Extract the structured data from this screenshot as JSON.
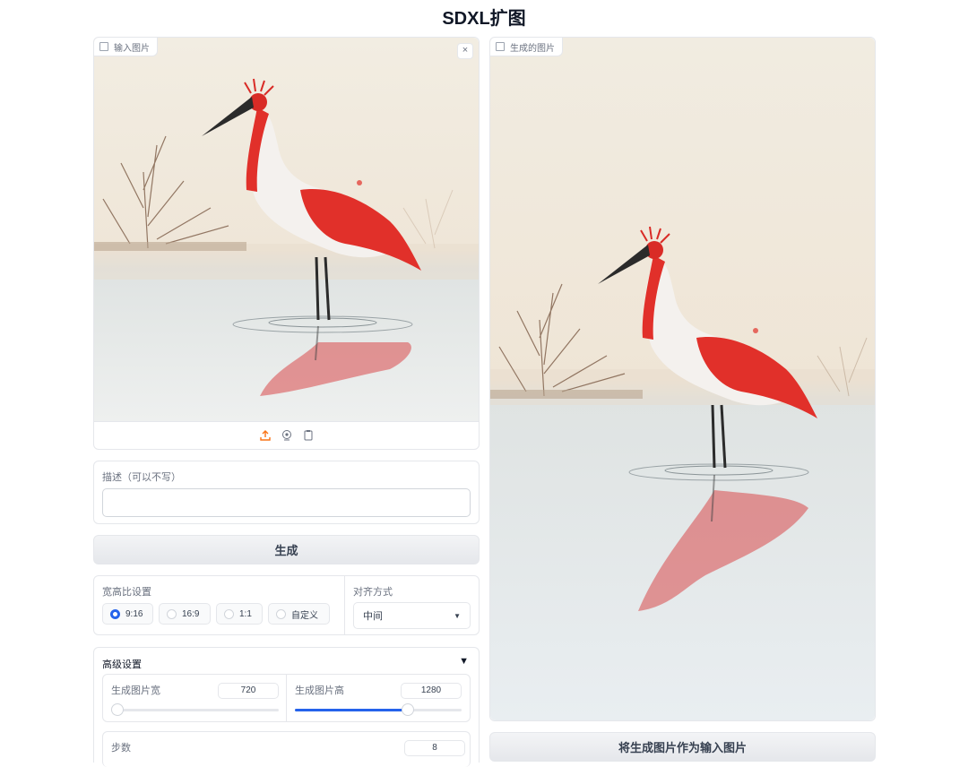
{
  "app": {
    "title": "SDXL扩图"
  },
  "input_image": {
    "label": "输入图片",
    "close_icon": "×"
  },
  "output_image": {
    "label": "生成的图片"
  },
  "description": {
    "label": "描述（可以不写）",
    "value": "",
    "placeholder": ""
  },
  "generate_button": {
    "label": "生成"
  },
  "aspect_ratio": {
    "label": "宽高比设置",
    "options": [
      "9:16",
      "16:9",
      "1:1",
      "自定义"
    ],
    "selected": "9:16"
  },
  "alignment": {
    "label": "对齐方式",
    "value": "中间"
  },
  "advanced": {
    "label": "高级设置",
    "toggle_icon": "▼",
    "width": {
      "label": "生成图片宽",
      "value": "720",
      "fraction": 0
    },
    "height": {
      "label": "生成图片高",
      "value": "1280",
      "fraction": 0.68
    },
    "steps": {
      "label": "步数",
      "value": "8"
    }
  },
  "use_as_input_button": {
    "label": "将生成图片作为输入图片"
  },
  "colors": {
    "accent": "#2563eb",
    "crane_red": "#e1302a"
  }
}
